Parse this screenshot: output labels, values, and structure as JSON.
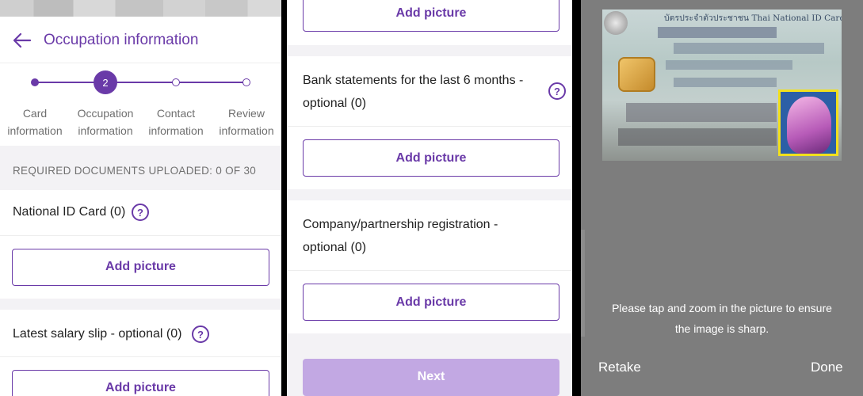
{
  "panel1": {
    "title": "Occupation information",
    "steps": [
      {
        "number": "",
        "label": "Card\ninformation"
      },
      {
        "number": "2",
        "label": "Occupation\ninformation"
      },
      {
        "number": "",
        "label": "Contact\ninformation"
      },
      {
        "number": "",
        "label": "Review\ninformation"
      }
    ],
    "step_labels": [
      "Card",
      "information",
      "Occupation",
      "information",
      "Contact",
      "information",
      "Review",
      "information"
    ],
    "required_documents": "REQUIRED DOCUMENTS UPLOADED: 0 OF 30",
    "docs": [
      {
        "title": "National ID Card (0)",
        "button": "Add picture"
      },
      {
        "title": "Latest salary slip - optional (0)",
        "button": "Add picture"
      }
    ],
    "help_glyph": "?"
  },
  "panel2": {
    "top_button": "Add picture",
    "docs": [
      {
        "title_line1": "Bank statements for the last 6 months -",
        "title_line2": "optional (0)",
        "button": "Add picture"
      },
      {
        "title_line1": "Company/partnership registration -",
        "title_line2": "optional (0)",
        "button": "Add picture"
      }
    ],
    "next_button": "Next",
    "next_color": "#c2a8e3"
  },
  "panel3": {
    "card_header_text": "บัตรประจำตัวประชาชน Thai National ID Card",
    "hint_line1": "Please tap and zoom in the picture to ensure",
    "hint_line2": "the image is sharp.",
    "retake": "Retake",
    "done": "Done"
  },
  "colors": {
    "accent": "#6a3aa8",
    "background_gray": "#f3f2f5",
    "camera_background": "#7d7d7d"
  }
}
